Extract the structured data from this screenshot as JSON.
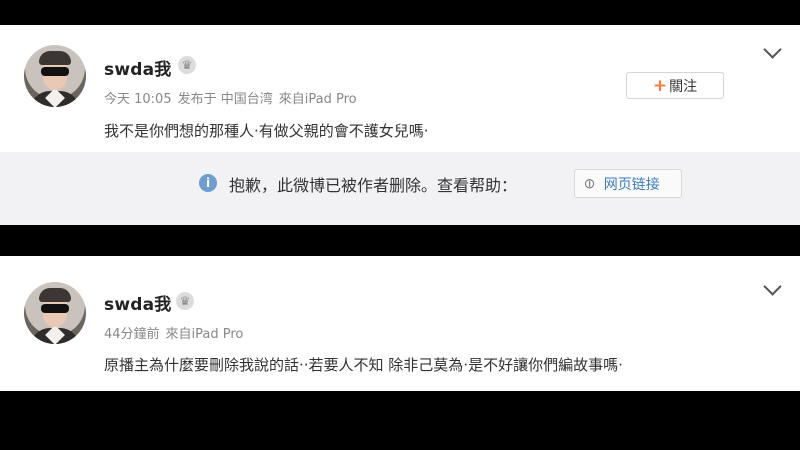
{
  "posts": [
    {
      "username": "swda我",
      "badge_icon": "crown-icon",
      "meta": {
        "time": "今天 10:05",
        "location": "发布于 中国台湾",
        "source": "來自iPad Pro"
      },
      "follow_button": {
        "plus": "+",
        "label": "關注"
      },
      "text": "我不是你們想的那種人·有做父親的會不護女兒嗎·",
      "deleted_notice": {
        "text": "抱歉，此微博已被作者删除。查看帮助：",
        "link_label": "网页链接"
      }
    },
    {
      "username": "swda我",
      "badge_icon": "crown-icon",
      "meta": {
        "time": "44分鐘前",
        "source": "來自iPad Pro"
      },
      "text": "原播主為什麼要刪除我說的話··若要人不知 除非己莫為·是不好讓你們編故事嗎·"
    }
  ],
  "icons": {
    "info": "i",
    "crown": "♛",
    "link": "⊘"
  }
}
